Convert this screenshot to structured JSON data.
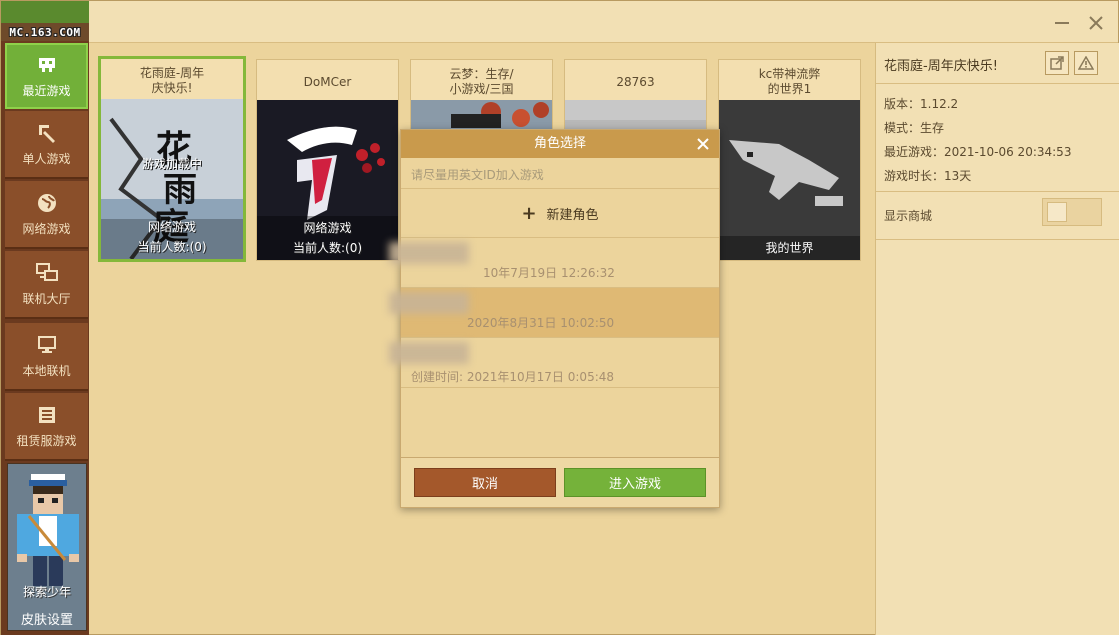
{
  "logo": "MC.163.COM",
  "window_controls": {
    "minimize": "minimize",
    "close": "close"
  },
  "sidebar": {
    "items": [
      {
        "label": "最近游戏",
        "icon": "gamepad-icon",
        "active": true
      },
      {
        "label": "单人游戏",
        "icon": "pickaxe-icon",
        "active": false
      },
      {
        "label": "网络游戏",
        "icon": "globe-icon",
        "active": false
      },
      {
        "label": "联机大厅",
        "icon": "network-icon",
        "active": false
      },
      {
        "label": "本地联机",
        "icon": "monitor-icon",
        "active": false
      },
      {
        "label": "租赁服游戏",
        "icon": "list-icon",
        "active": false
      }
    ],
    "skin": {
      "name": "探索少年",
      "label": "皮肤设置"
    }
  },
  "cards": [
    {
      "title": "花雨庭-周年\n庆快乐!",
      "overlay": "游戏加载中",
      "mode": "网络游戏",
      "players": "当前人数:(0)",
      "selected": true
    },
    {
      "title": "DoMCer",
      "mode": "网络游戏",
      "players": "当前人数:(0)",
      "selected": false
    },
    {
      "title": "云梦：生存/\n小游戏/三国",
      "selected": false
    },
    {
      "title": "28763",
      "selected": false
    },
    {
      "title": "kc带神流弊\n的世界1",
      "mode": "我的世界",
      "selected": false
    }
  ],
  "details": {
    "title": "花雨庭-周年庆快乐!",
    "version": "版本：1.12.2",
    "mode": "模式：生存",
    "last_played": "最近游戏：2021-10-06 20:34:53",
    "play_time": "游戏时长：13天",
    "show_shop": "显示商城"
  },
  "dialog": {
    "title": "角色选择",
    "hint": "请尽量用英文ID加入游戏",
    "new_role": "新建角色",
    "roles": [
      {
        "time": "10年7月19日 12:26:32"
      },
      {
        "time": "2020年8月31日 10:02:50"
      },
      {
        "time": "创建时间: 2021年10月17日 0:05:48"
      }
    ],
    "cancel": "取消",
    "enter": "进入游戏"
  }
}
